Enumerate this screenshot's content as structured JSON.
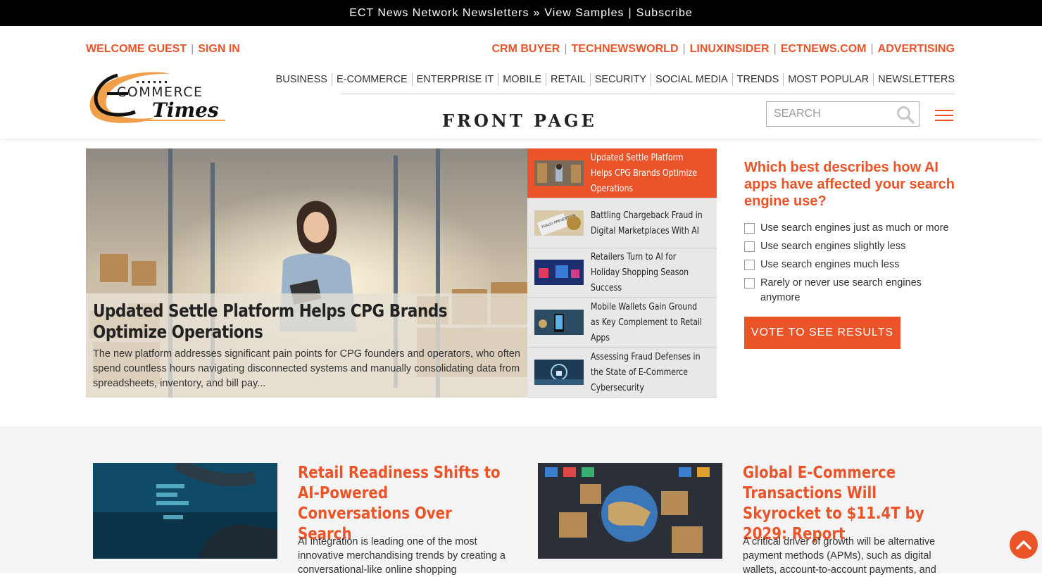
{
  "topbar": {
    "newsletters": "ECT News Network Newsletters",
    "sep1": "»",
    "samples": "View Samples",
    "sep2": "|",
    "subscribe": "Subscribe"
  },
  "account": {
    "welcome": "WELCOME GUEST",
    "sep": "|",
    "signin": "SIGN IN"
  },
  "network": [
    "CRM BUYER",
    "TECHNEWSWORLD",
    "LINUXINSIDER",
    "ECTNEWS.COM",
    "ADVERTISING"
  ],
  "network_sep": "|",
  "logo": {
    "line1": "COMMERCE",
    "line2": "Times"
  },
  "nav": [
    "BUSINESS",
    "E-COMMERCE",
    "ENTERPRISE IT",
    "MOBILE",
    "RETAIL",
    "SECURITY",
    "SOCIAL MEDIA",
    "TRENDS",
    "MOST POPULAR",
    "NEWSLETTERS"
  ],
  "page_title": "FRONT PAGE",
  "search": {
    "placeholder": "SEARCH",
    "icon": "search-icon"
  },
  "menu_icon": "hamburger-menu-icon",
  "hero": {
    "title": "Updated Settle Platform Helps CPG Brands Optimize Operations",
    "summary": "The new platform addresses significant pain points for CPG founders and operators, who often spend countless hours navigating disconnected systems and manually consolidating data from spreadsheets, inventory, and bill pay..."
  },
  "side_stories": [
    {
      "title": "Updated Settle Platform Helps CPG Brands Optimize Operations",
      "active": true
    },
    {
      "title": "Battling Chargeback Fraud in Digital Marketplaces With AI",
      "active": false,
      "thumb_text": "FRAUD PREVENTION"
    },
    {
      "title": "Retailers Turn to AI for Holiday Shopping Season Success",
      "active": false
    },
    {
      "title": "Mobile Wallets Gain Ground as Key Complement to Retail Apps",
      "active": false
    },
    {
      "title": "Assessing Fraud Defenses in the State of E-Commerce Cybersecurity",
      "active": false
    }
  ],
  "poll": {
    "question": "Which best describes how AI apps have affected your search engine use?",
    "options": [
      "Use search engines just as much or more",
      "Use search engines slightly less",
      "Use search engines much less",
      "Rarely or never use search engines anymore"
    ],
    "button": "VOTE TO SEE RESULTS"
  },
  "cards": [
    {
      "title": "Retail Readiness Shifts to AI-Powered Conversations Over Search",
      "summary": "AI integration is leading one of the most innovative merchandising trends by creating a conversational-like online shopping"
    },
    {
      "title": "Global E-Commerce Transactions Will Skyrocket to $11.4T by 2029: Report",
      "summary": "A critical driver of growth will be alternative payment methods (APMs), such as digital wallets, account-to-account payments, and"
    }
  ],
  "colors": {
    "accent": "#ea5428",
    "topbar": "#000000",
    "lower_bg": "#f4f4f4"
  },
  "back_to_top_icon": "chevron-up-icon"
}
